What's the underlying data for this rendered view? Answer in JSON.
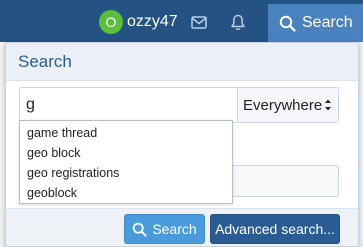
{
  "header": {
    "user": {
      "initial": "O",
      "name": "ozzy47"
    },
    "search_tab_label": "Search"
  },
  "panel": {
    "title": "Search",
    "query_value": "g",
    "scope_selected": "Everywhere",
    "suggestions": [
      "game thread",
      "geo block",
      "geo registrations",
      "geoblock"
    ],
    "search_button_label": "Search",
    "advanced_button_label": "Advanced search..."
  },
  "colors": {
    "nav_bg": "#245283",
    "search_tab_bg": "#4a82c0",
    "avatar_bg": "#5bbf3c",
    "primary_button": "#4a9bdc",
    "advanced_button": "#2a5b93",
    "panel_title": "#2b5c91"
  },
  "icons": [
    "envelope-icon",
    "bell-icon",
    "search-icon",
    "caret-updown-icon"
  ]
}
